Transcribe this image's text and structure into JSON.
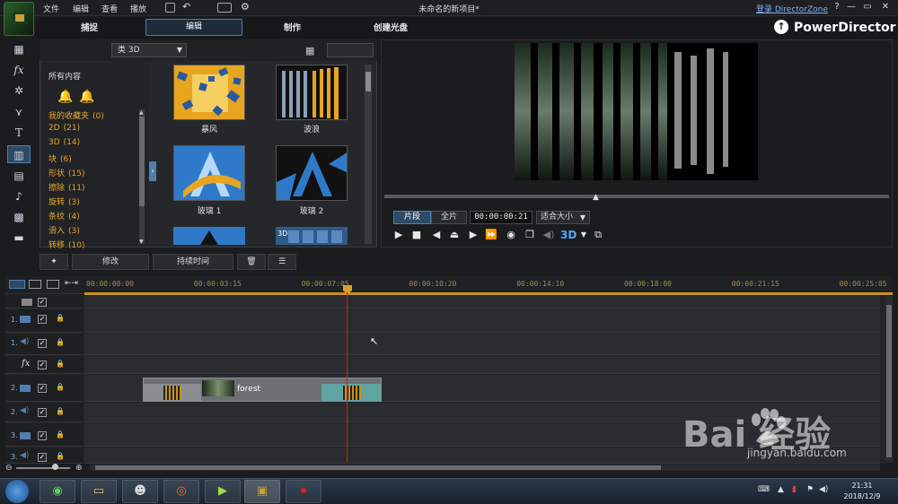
{
  "menu": {
    "file": "文件",
    "edit": "编辑",
    "view": "查看",
    "play": "播放"
  },
  "title": "未命名的新项目*",
  "login": "登录 DirectorZone",
  "window_buttons": {
    "help": "?",
    "minimize": "—",
    "restore": "▭",
    "close": "✕"
  },
  "modes": {
    "capture": "捕捉",
    "edit": "编辑",
    "produce": "制作",
    "disc": "创建光盘"
  },
  "brand": "PowerDirector",
  "library": {
    "category_dropdown": "类 3D",
    "all_content": "所有内容",
    "categories": [
      {
        "label": "我的收藏夹",
        "count": "(0)"
      },
      {
        "label": "2D",
        "count": "(21)"
      },
      {
        "label": "3D",
        "count": "(14)"
      },
      {
        "label": "块",
        "count": "(6)"
      },
      {
        "label": "形状",
        "count": "(15)"
      },
      {
        "label": "擦除",
        "count": "(11)"
      },
      {
        "label": "旋转",
        "count": "(3)"
      },
      {
        "label": "条纹",
        "count": "(4)"
      },
      {
        "label": "滑入",
        "count": "(3)"
      },
      {
        "label": "转移",
        "count": "(10)"
      }
    ],
    "transitions": [
      "暴风",
      "波浪",
      "玻璃 1",
      "玻璃 2"
    ]
  },
  "preview": {
    "segment": "片段",
    "full": "全片",
    "timecode": "00:00:00:21",
    "fit": "适合大小",
    "three_d": "3D"
  },
  "edit_toolbar": {
    "modify": "修改",
    "duration": "持续时间"
  },
  "timeline": {
    "timecodes": [
      "00:00:00:00",
      "00:00:03:15",
      "00:00:07:05",
      "00:00:10:20",
      "00:00:14:10",
      "00:00:18:00",
      "00:00:21:15",
      "00:00:25:05"
    ],
    "clip_name": "forest",
    "track_numbers": [
      "1.",
      "1.",
      "fx",
      "2.",
      "2.",
      "3.",
      "3."
    ]
  },
  "clock": {
    "time": "21:31",
    "date": "2018/12/9"
  },
  "watermark": {
    "main": "Bai  经验",
    "sub": "jingyan.baidu.com"
  },
  "colors": {
    "accent": "#4f7fb0",
    "category": "#e6a52a",
    "playhead": "#d02020"
  }
}
